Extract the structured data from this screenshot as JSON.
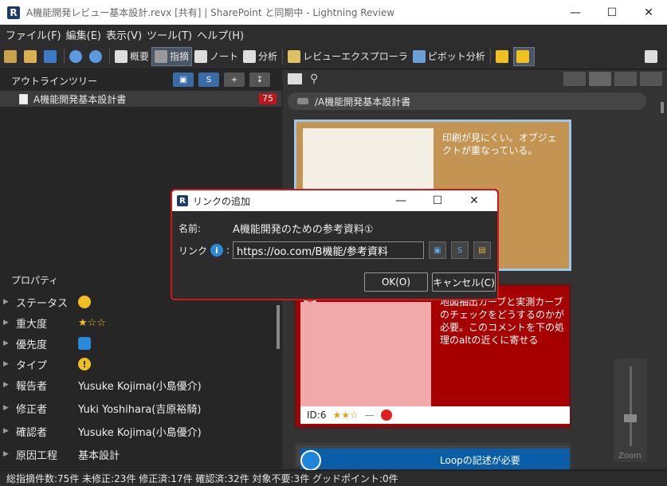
{
  "window": {
    "title": "A機能開発レビュー基本設計.revx [共有] | SharePoint と同期中 - Lightning Review",
    "logo": "R",
    "minimize": "—",
    "maximize": "☐",
    "close": "✕"
  },
  "menu": [
    "ファイル(F)",
    "編集(E)",
    "表示(V)",
    "ツール(T)",
    "ヘルプ(H)"
  ],
  "toolbar": {
    "summary": "概要",
    "issues": "指摘",
    "note": "ノート",
    "analysis": "分析",
    "review_explorer": "レビューエクスプローラ",
    "pivot": "ピボット分析"
  },
  "outline": {
    "header": "アウトラインツリー",
    "item_label": "A機能開発基本設計書",
    "item_count": "75"
  },
  "properties": {
    "header": "プロパティ",
    "rows": [
      {
        "label": "ステータス",
        "value": ""
      },
      {
        "label": "重大度",
        "value": "★☆☆"
      },
      {
        "label": "優先度",
        "value": ""
      },
      {
        "label": "タイプ",
        "value": "!"
      },
      {
        "label": "報告者",
        "value": "Yusuke Kojima(小島優介)"
      },
      {
        "label": "修正者",
        "value": "Yuki Yoshihara(吉原裕騎)"
      },
      {
        "label": "確認者",
        "value": "Yusuke Kojima(小島優介)"
      },
      {
        "label": "原因工程",
        "value": "基本設計"
      }
    ]
  },
  "right": {
    "path": "/A機能開発基本設計書",
    "card1_text": "印刷が見にくい。オブジェクトが重なっている。",
    "card2_text": "地図抽出カーブと実測カーブのチェックをどうするのかが必要。このコメントを下の処理のaltの近くに寄せる",
    "card2_id": "ID:6",
    "card2_stars": "★★☆",
    "card2_dash": "—",
    "card3_text": "Loopの記述が必要",
    "zoom_label": "Zoom"
  },
  "dialog": {
    "title": "リンクの追加",
    "name_label": "名前:",
    "name_value": "A機能開発のための参考資料①",
    "link_label": "リンク",
    "link_colon": ":",
    "info": "i",
    "link_value": "https://oo.com/B機能/参考資料",
    "ok": "OK(O)",
    "cancel": "キャンセル(C)",
    "minimize": "—",
    "maximize": "☐",
    "close": "✕"
  },
  "status": "総指摘件数:75件 未修正:23件 修正済:17件 確認済:32件 対象不要:3件 グッドポイント:0件"
}
